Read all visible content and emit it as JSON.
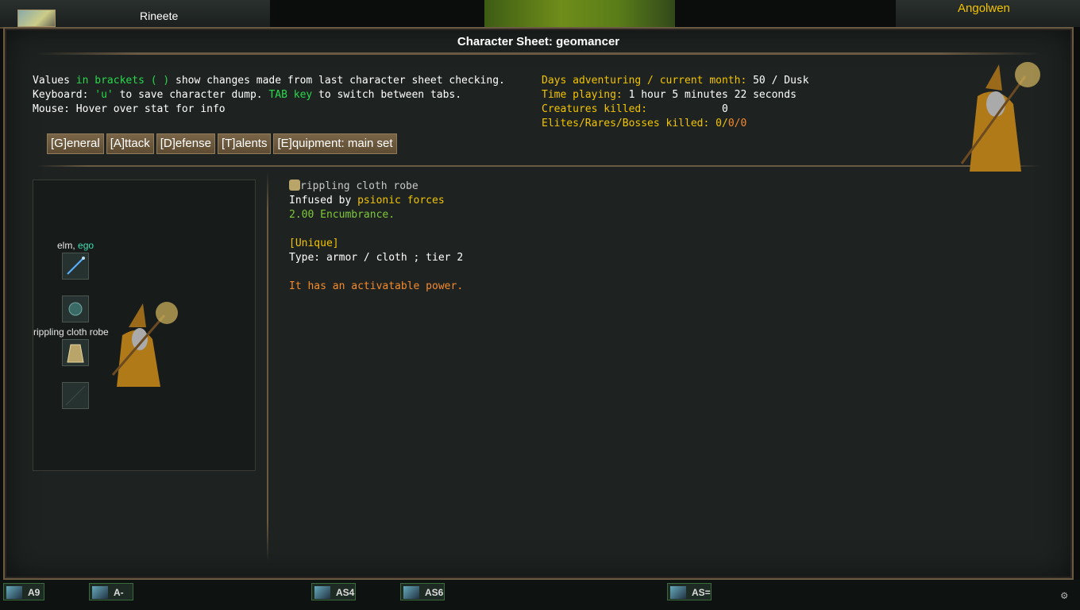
{
  "top": {
    "left_name": "Rineete",
    "right_name": "Angolwen"
  },
  "window": {
    "title": "Character Sheet: geomancer"
  },
  "help": {
    "line1_a": "Values ",
    "line1_b": "in brackets ( )",
    "line1_c": " show changes made from last character sheet checking.",
    "line2_a": "Keyboard: ",
    "line2_b": "'u'",
    "line2_c": " to save character dump. ",
    "line2_d": "TAB key",
    "line2_e": " to switch between tabs.",
    "line3": "Mouse: Hover over stat for info"
  },
  "stats": {
    "days_label": "Days adventuring / current month:",
    "days_value": " 50 / Dusk",
    "time_label": "Time playing:",
    "time_value": " 1 hour 5 minutes 22 seconds",
    "killed_label": "Creatures killed:",
    "killed_value": "0",
    "elites_label": "Elites/Rares/Bosses killed:",
    "elites_a": " 0/",
    "elites_b": "0/0"
  },
  "tabs": [
    {
      "label": "[G]eneral"
    },
    {
      "label": "[A]ttack"
    },
    {
      "label": "[D]efense"
    },
    {
      "label": "[T]alents"
    },
    {
      "label": "[E]quipment: main set"
    }
  ],
  "doll": {
    "weapon_name": "elm, ",
    "weapon_ego": "ego",
    "armor_label": "rippling cloth robe"
  },
  "item": {
    "name": "rippling cloth robe",
    "infused_a": "Infused by ",
    "infused_b": "psionic forces",
    "encumbrance": "2.00 Encumbrance.",
    "unique": "[Unique]",
    "type": "Type: armor / cloth ; tier 2",
    "power": "It has an activatable power."
  },
  "hotbar": [
    {
      "label": "A9"
    },
    {
      "label": "A-"
    },
    {
      "label": "AS4"
    },
    {
      "label": "AS6"
    },
    {
      "label": "AS="
    }
  ],
  "colors": {
    "green": "#28d84a",
    "yellow": "#f2c300",
    "orange": "#f58a2b",
    "frame": "#6b5a42"
  }
}
